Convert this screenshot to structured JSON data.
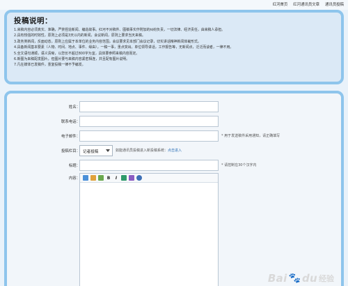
{
  "top_nav": {
    "links": [
      "红河首页",
      "红河通讯员文章",
      "通讯员投稿"
    ]
  },
  "notice": {
    "title": "投稿说明：",
    "lines": [
      "1.来稿内容必须真实、准确，严禁捏造新闻、编造故事。红河不对稿件、图稿事实作附加的纠纷负责，一切法律、经济责任，由来稿人承担。",
      "2.具有较强的时效性，原则上必须是3天以内的新闻，会议新闻，原则上要求当天来稿。",
      "3.政务类新闻，反面动态，原则上应属于本单位的业务内容范围，会议要求见本部门会议记录，切实讲话精神新闻体裁形式。",
      "4.具备新闻基本要素（人物、时间、地点、事件、缘由），一稿一事，重点突出。单位领导讲话，工作报告等，无新闻点，泛泛而谈者，一律不用。",
      "5.全文语句通顺，语义清晰，以您长不超过800字为宜，具体要参照来稿内容而定。",
      "6.新图为来稿配发图片，但图片要与来稿内容紧密相连，并且配有图片说明。",
      "7.凡在媒体已发稿件，重复投稿一律不予编发。"
    ]
  },
  "form": {
    "name_label": "姓名：",
    "phone_label": "联系电话：",
    "email_label": "电子邮件：",
    "email_hint": "* 用于发送稿件采用通知，请正确填写",
    "column_label": "投稿栏目：",
    "column_selected": "记者投稿",
    "column_hint": "如能通讯员投稿进入新投稿系统：",
    "column_hint_link": "点击进入",
    "title_label": "标题：",
    "title_hint": "* 请控制在30个汉字内",
    "content_label": "内容："
  },
  "editor_toolbar": {
    "bold": "B",
    "italic": "I"
  },
  "watermark": {
    "brand": "Bai",
    "suffix": "du",
    "sub": "经验"
  }
}
